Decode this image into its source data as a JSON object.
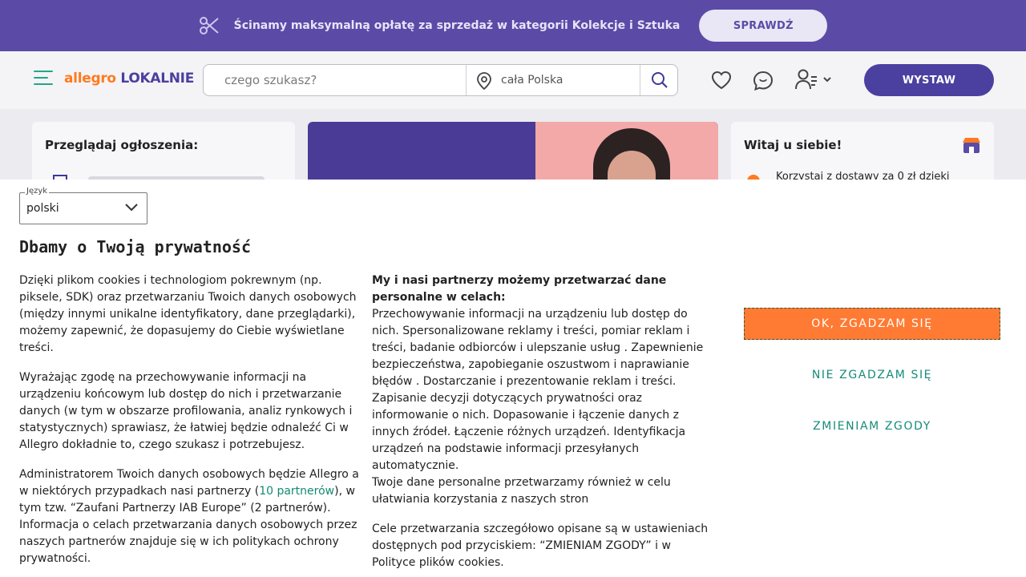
{
  "promo": {
    "text": "Ścinamy maksymalną opłatę za sprzedaż w kategorii Kolekcje i Sztuka",
    "button": "SPRAWDŹ",
    "icon": "scissors-icon"
  },
  "header": {
    "logo_part1": "allegro",
    "logo_part2": " LOKALNIE",
    "search_placeholder": "czego szukasz?",
    "location": "cała Polska",
    "cta": "WYSTAW"
  },
  "background": {
    "browse_title": "Przeglądaj ogłoszenia:",
    "welcome_title": "Witaj u siebie!",
    "welcome_text": "Korzystaj z dostawy za 0 zł dzięki"
  },
  "consent": {
    "language_label": "Język",
    "language_value": "polski",
    "title": "Dbamy o Twoją prywatność",
    "col1_p1": "Dzięki plikom cookies i technologiom pokrewnym (np. piksele, SDK) oraz przetwarzaniu Twoich danych osobowych (między innymi unikalne identyfikatory, dane przeglądarki), możemy zapewnić, że dopasujemy do Ciebie wyświetlane treści.",
    "col1_p2": "Wyrażając zgodę na przechowywanie informacji na urządzeniu końcowym lub dostęp do nich i przetwarzanie danych (w tym w obszarze profilowania, analiz rynkowych i statystycznych) sprawiasz, że łatwiej będzie odnaleźć Ci w Allegro dokładnie to, czego szukasz i potrzebujesz.",
    "col1_p3_a": "Administratorem Twoich danych osobowych będzie Allegro a w niektórych przypadkach nasi partnerzy (",
    "col1_p3_link": "10 partnerów",
    "col1_p3_b": "), w tym tzw. “Zaufani Partnerzy IAB Europe” (2 partnerów). Informacja o celach przetwarzania danych osobowych przez naszych partnerów znajduje się w ich politykach ochrony prywatności.",
    "col2_lead": "My i nasi partnerzy możemy przetwarzać dane personalne w celach:",
    "col2_purposes": "Przechowywanie informacji na urządzeniu lub dostęp do nich. Spersonalizowane reklamy i treści, pomiar reklam i treści, badanie odbiorców i ulepszanie usług . Zapewnienie bezpieczeństwa, zapobieganie oszustwom i naprawianie błędów . Dostarczanie i prezentowanie reklam i treści. Zapisanie decyzji dotyczących prywatności oraz informowanie o nich. Dopasowanie i łączenie danych z innych źródeł. Łączenie różnych urządzeń. Identyfikacja urządzeń na podstawie informacji przesyłanych automatycznie.",
    "col2_also": "Twoje dane personalne przetwarzamy również w celu ułatwiania korzystania z naszych stron",
    "col2_p2": "Cele przetwarzania szczegółowo opisane są w ustawieniach dostępnych pod przyciskiem: “ZMIENIAM ZGODY” i w Polityce plików cookies.",
    "btn_accept": "OK, ZGADZAM SIĘ",
    "btn_reject": "NIE ZGADZAM SIĘ",
    "btn_change": "ZMIENIAM ZGODY"
  },
  "colors": {
    "promo_bg": "#5b4ba7",
    "brand_orange": "#ff7a21",
    "brand_purple": "#4b3fa0",
    "link_green": "#168b7a"
  }
}
